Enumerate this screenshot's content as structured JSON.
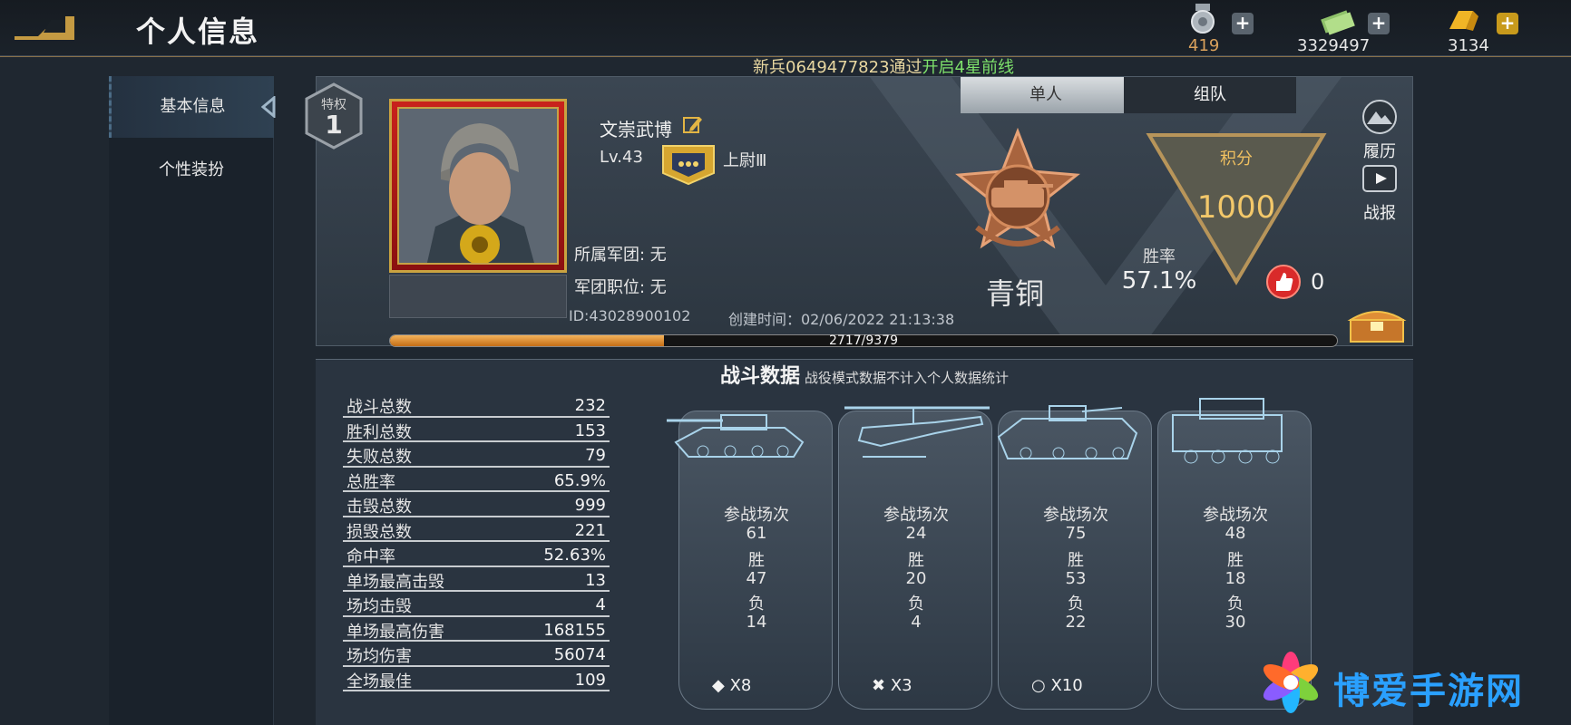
{
  "header": {
    "title": "个人信息",
    "currencies": [
      {
        "icon": "medal-currency-icon",
        "value": "419"
      },
      {
        "icon": "cash-currency-icon",
        "value": "3329497"
      },
      {
        "icon": "gold-bar-currency-icon",
        "value": "3134"
      }
    ],
    "ticker": {
      "prefix": "新兵0649477823通过",
      "highlight": "开启4星前线"
    }
  },
  "sidebar": {
    "items": [
      {
        "label": "基本信息",
        "active": true
      },
      {
        "label": "个性装扮",
        "active": false
      }
    ]
  },
  "profile": {
    "privilege": {
      "label": "特权",
      "level": "1"
    },
    "name": "文崇武博",
    "level": "Lv.43",
    "rank": "上尉Ⅲ",
    "legion": "所属军团: 无",
    "legion_position": "军团职位: 无",
    "id": "ID:43028900102",
    "created": "创建时间：02/06/2022 21:13:38",
    "xp": {
      "current": 2717,
      "max": 9379,
      "text": "2717/9379"
    },
    "mode_tabs": [
      "单人",
      "组队"
    ],
    "tier": "青铜",
    "score_label": "积分",
    "score": "1000",
    "winrate_label": "胜率",
    "winrate": "57.1%",
    "likes": "0",
    "side_buttons": [
      "履历",
      "战报"
    ]
  },
  "battle_data": {
    "title": "战斗数据",
    "subtitle": "战役模式数据不计入个人数据统计",
    "stats": [
      {
        "label": "战斗总数",
        "value": "232"
      },
      {
        "label": "胜利总数",
        "value": "153"
      },
      {
        "label": "失败总数",
        "value": "79"
      },
      {
        "label": "总胜率",
        "value": "65.9%"
      },
      {
        "label": "击毁总数",
        "value": "999"
      },
      {
        "label": "损毁总数",
        "value": "221"
      },
      {
        "label": "命中率",
        "value": "52.63%"
      },
      {
        "label": "单场最高击毁",
        "value": "13"
      },
      {
        "label": "场均击毁",
        "value": "4"
      },
      {
        "label": "单场最高伤害",
        "value": "168155"
      },
      {
        "label": "场均伤害",
        "value": "56074"
      },
      {
        "label": "全场最佳",
        "value": "109"
      }
    ],
    "vehicles": [
      {
        "type": "tank",
        "battles_label": "参战场次",
        "battles": "61",
        "win_label": "胜",
        "wins": "47",
        "loss_label": "负",
        "losses": "14",
        "count": "X8",
        "symbol": "◆"
      },
      {
        "type": "helicopter",
        "battles_label": "参战场次",
        "battles": "24",
        "win_label": "胜",
        "wins": "20",
        "loss_label": "负",
        "losses": "4",
        "count": "X3",
        "symbol": "✖"
      },
      {
        "type": "ifv",
        "battles_label": "参战场次",
        "battles": "75",
        "win_label": "胜",
        "wins": "53",
        "loss_label": "负",
        "losses": "22",
        "count": "X10",
        "symbol": "○"
      },
      {
        "type": "artillery",
        "battles_label": "参战场次",
        "battles": "48",
        "win_label": "胜",
        "wins": "18",
        "loss_label": "负",
        "losses": "30",
        "count": "",
        "symbol": ""
      }
    ]
  },
  "watermark": "博爱手游网"
}
